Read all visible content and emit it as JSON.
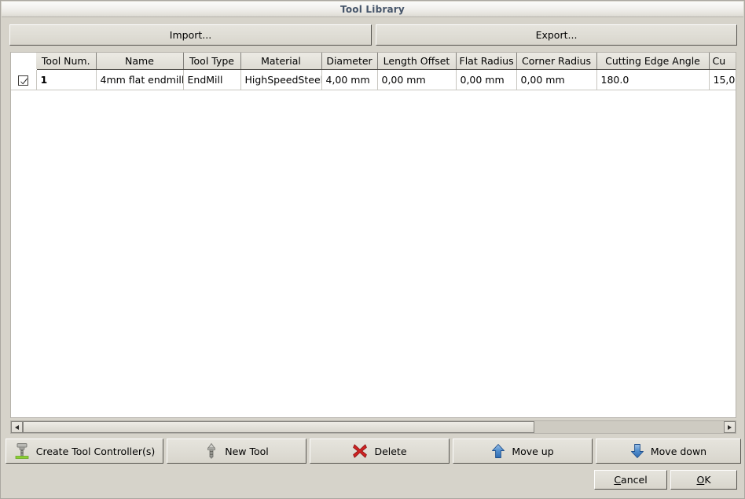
{
  "window": {
    "title": "Tool Library"
  },
  "toolbar": {
    "import_label": "Import...",
    "export_label": "Export..."
  },
  "table": {
    "columns": [
      {
        "key": "checkbox",
        "label": ""
      },
      {
        "key": "tool_num",
        "label": "Tool Num."
      },
      {
        "key": "name",
        "label": "Name"
      },
      {
        "key": "tool_type",
        "label": "Tool Type"
      },
      {
        "key": "material",
        "label": "Material"
      },
      {
        "key": "diameter",
        "label": "Diameter"
      },
      {
        "key": "length_offset",
        "label": "Length Offset"
      },
      {
        "key": "flat_radius",
        "label": "Flat Radius"
      },
      {
        "key": "corner_radius",
        "label": "Corner Radius"
      },
      {
        "key": "cutting_edge_angle",
        "label": "Cutting Edge Angle"
      },
      {
        "key": "cutting_edge_height",
        "label": "Cu"
      }
    ],
    "rows": [
      {
        "checked": true,
        "tool_num": "1",
        "name": "4mm flat endmill",
        "tool_type": "EndMill",
        "material": "HighSpeedSteel",
        "diameter": "4,00 mm",
        "length_offset": "0,00 mm",
        "flat_radius": "0,00 mm",
        "corner_radius": "0,00 mm",
        "cutting_edge_angle": "180.0",
        "cutting_edge_height": "15,0"
      }
    ]
  },
  "scrollbar": {
    "left_arrow": "left-arrow",
    "right_arrow": "right-arrow",
    "thumb_fraction_percent": 73
  },
  "actions": {
    "create_tool_controllers": "Create Tool Controller(s)",
    "new_tool": "New Tool",
    "delete": "Delete",
    "move_up": "Move up",
    "move_down": "Move down"
  },
  "dialog": {
    "cancel_accel": "C",
    "cancel_rest": "ancel",
    "ok_accel": "O",
    "ok_rest": "K"
  },
  "colors": {
    "window_bg": "#d6d3ca",
    "title_text": "#46556a",
    "button_face": "#dfddd5",
    "list_bg": "#ffffff",
    "delete_red": "#cf2222",
    "arrow_blue": "#2f72c4",
    "tool_green": "#7ec82b"
  }
}
